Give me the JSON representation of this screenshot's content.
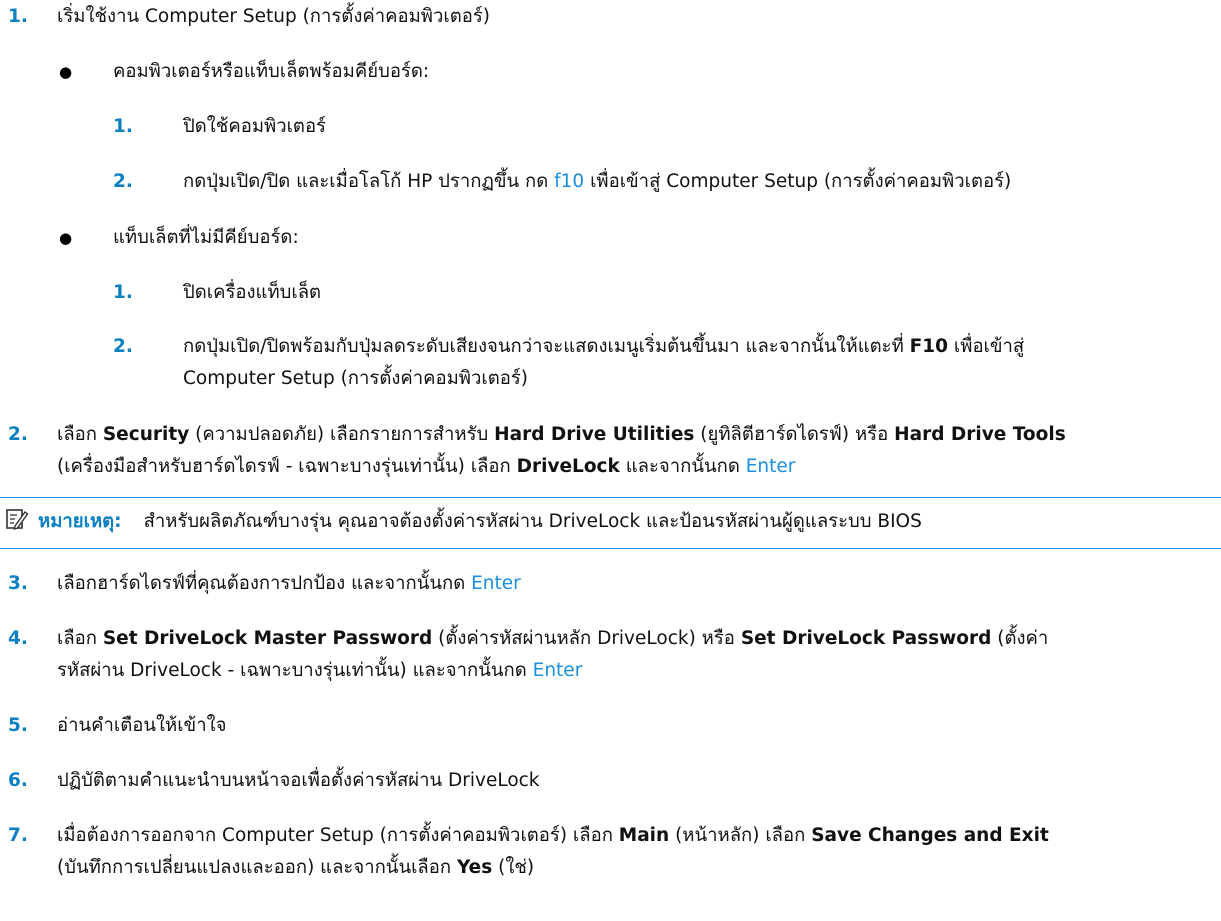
{
  "steps": {
    "s1": {
      "num": "1.",
      "text": "เริ่มใช้งาน Computer Setup (การตั้งค่าคอมพิวเตอร์)"
    },
    "b1": {
      "text": "คอมพิวเตอร์หรือแท็บเล็ตพร้อมคีย์บอร์ด:"
    },
    "b1_1": {
      "num": "1.",
      "text": "ปิดใช้คอมพิวเตอร์"
    },
    "b1_2": {
      "num": "2.",
      "pre": "กดปุ่มเปิด/ปิด และเมื่อโลโก้ HP ปรากฏขึ้น กด ",
      "key": "f10",
      "post": " เพื่อเข้าสู่ Computer Setup (การตั้งค่าคอมพิวเตอร์)"
    },
    "b2": {
      "text": "แท็บเล็ตที่ไม่มีคีย์บอร์ด:"
    },
    "b2_1": {
      "num": "1.",
      "text": "ปิดเครื่องแท็บเล็ต"
    },
    "b2_2": {
      "num": "2.",
      "pre": "กดปุ่มเปิด/ปิดพร้อมกับปุ่มลดระดับเสียงจนกว่าจะแสดงเมนูเริ่มต้นขึ้นมา และจากนั้นให้แตะที่ ",
      "key": "F10",
      "post": " เพื่อเข้าสู่",
      "line2": "Computer Setup (การตั้งค่าคอมพิวเตอร์)"
    },
    "s2": {
      "num": "2.",
      "a": "เลือก ",
      "b": "Security",
      "c": " (ความปลอดภัย) เลือกรายการสำหรับ ",
      "d": "Hard Drive Utilities",
      "e": " (ยูทิลิตีฮาร์ดไดรฟ์) หรือ ",
      "f": "Hard Drive Tools",
      "g": "(เครื่องมือสำหรับฮาร์ดไดรฟ์ - เฉพาะบางรุ่นเท่านั้น) เลือก ",
      "h": "DriveLock",
      "i": " และจากนั้นกด ",
      "j": "Enter"
    },
    "note": {
      "label": "หมายเหตุ:",
      "text": "สำหรับผลิตภัณฑ์บางรุ่น คุณอาจต้องตั้งค่ารหัสผ่าน DriveLock และป้อนรหัสผ่านผู้ดูแลระบบ BIOS",
      "icon": "note-pencil-icon",
      "accent": "#1a8fe0"
    },
    "s3": {
      "num": "3.",
      "text": "เลือกฮาร์ดไดรฟ์ที่คุณต้องการปกป้อง และจากนั้นกด ",
      "key": "Enter"
    },
    "s4": {
      "num": "4.",
      "a": "เลือก ",
      "b": "Set DriveLock Master Password",
      "c": " (ตั้งค่ารหัสผ่านหลัก DriveLock) หรือ ",
      "d": "Set DriveLock Password",
      "e": " (ตั้งค่า",
      "f": "รหัสผ่าน DriveLock - เฉพาะบางรุ่นเท่านั้น) และจากนั้นกด ",
      "g": "Enter"
    },
    "s5": {
      "num": "5.",
      "text": "อ่านคำเตือนให้เข้าใจ"
    },
    "s6": {
      "num": "6.",
      "text": "ปฏิบัติตามคำแนะนำบนหน้าจอเพื่อตั้งค่ารหัสผ่าน DriveLock"
    },
    "s7": {
      "num": "7.",
      "a": "เมื่อต้องการออกจาก Computer Setup (การตั้งค่าคอมพิวเตอร์) เลือก ",
      "b": "Main",
      "c": " (หน้าหลัก) เลือก ",
      "d": "Save Changes and Exit",
      "e": "(บันทึกการเปลี่ยนแปลงและออก) และจากนั้นเลือก ",
      "f": "Yes",
      "g": " (ใช่)"
    }
  },
  "colors": {
    "number": "#0a7fc2",
    "link": "#1a8fe0",
    "text": "#111111"
  }
}
